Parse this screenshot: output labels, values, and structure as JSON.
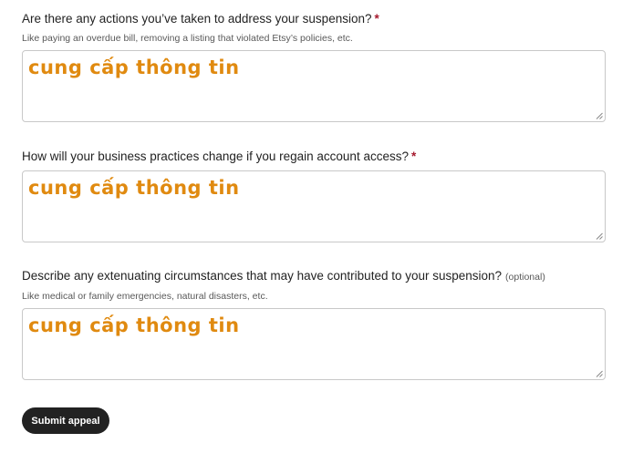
{
  "questions": [
    {
      "label": "Are there any actions you’ve taken to address your suspension?",
      "required_mark": "*",
      "hint": "Like paying an overdue bill, removing a listing that violated Etsy’s policies, etc.",
      "value": "cung cấp thông tin"
    },
    {
      "label": "How will your business practices change if you regain account access?",
      "required_mark": "*",
      "value": "cung cấp thông tin"
    },
    {
      "label": "Describe any extenuating circumstances that may have contributed to your suspension?",
      "optional_tag": "(optional)",
      "hint": "Like medical or family emergencies, natural disasters, etc.",
      "value": "cung cấp thông tin"
    }
  ],
  "submit_label": "Submit appeal",
  "colors": {
    "required": "#a61a2e",
    "value_text": "#e08a10",
    "button_bg": "#222222"
  }
}
